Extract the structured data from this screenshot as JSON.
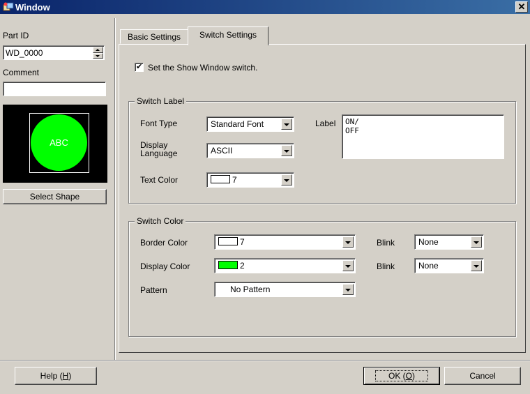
{
  "window": {
    "title": "Window",
    "close_glyph": "✕"
  },
  "left": {
    "part_id_label": "Part ID",
    "part_id_value": "WD_0000",
    "comment_label": "Comment",
    "comment_value": "",
    "preview_text": "ABC",
    "preview_color": "#00ff00",
    "select_shape": "Select Shape"
  },
  "tabs": [
    {
      "label": "Basic Settings",
      "active": false
    },
    {
      "label": "Switch Settings",
      "active": true
    }
  ],
  "show_switch": {
    "label": "Set the Show Window switch.",
    "checked": true
  },
  "switch_label": {
    "group_title": "Switch Label",
    "font_type_label": "Font Type",
    "font_type_value": "Standard Font",
    "display_language_label": "Display Language",
    "display_language_value": "ASCII",
    "text_color_label": "Text Color",
    "text_color_value": "7",
    "text_color_swatch": "#ffffff",
    "label_label": "Label",
    "label_value": "ON/\nOFF"
  },
  "switch_color": {
    "group_title": "Switch Color",
    "border_color_label": "Border Color",
    "border_color_value": "7",
    "border_color_swatch": "#ffffff",
    "display_color_label": "Display Color",
    "display_color_value": "2",
    "display_color_swatch": "#00ff00",
    "pattern_label": "Pattern",
    "pattern_value": "No Pattern",
    "blink1_label": "Blink",
    "blink1_value": "None",
    "blink2_label": "Blink",
    "blink2_value": "None"
  },
  "footer": {
    "help_prefix": "Help (",
    "help_key": "H",
    "help_suffix": ")",
    "ok_prefix": "OK (",
    "ok_key": "O",
    "ok_suffix": ")",
    "cancel": "Cancel"
  }
}
